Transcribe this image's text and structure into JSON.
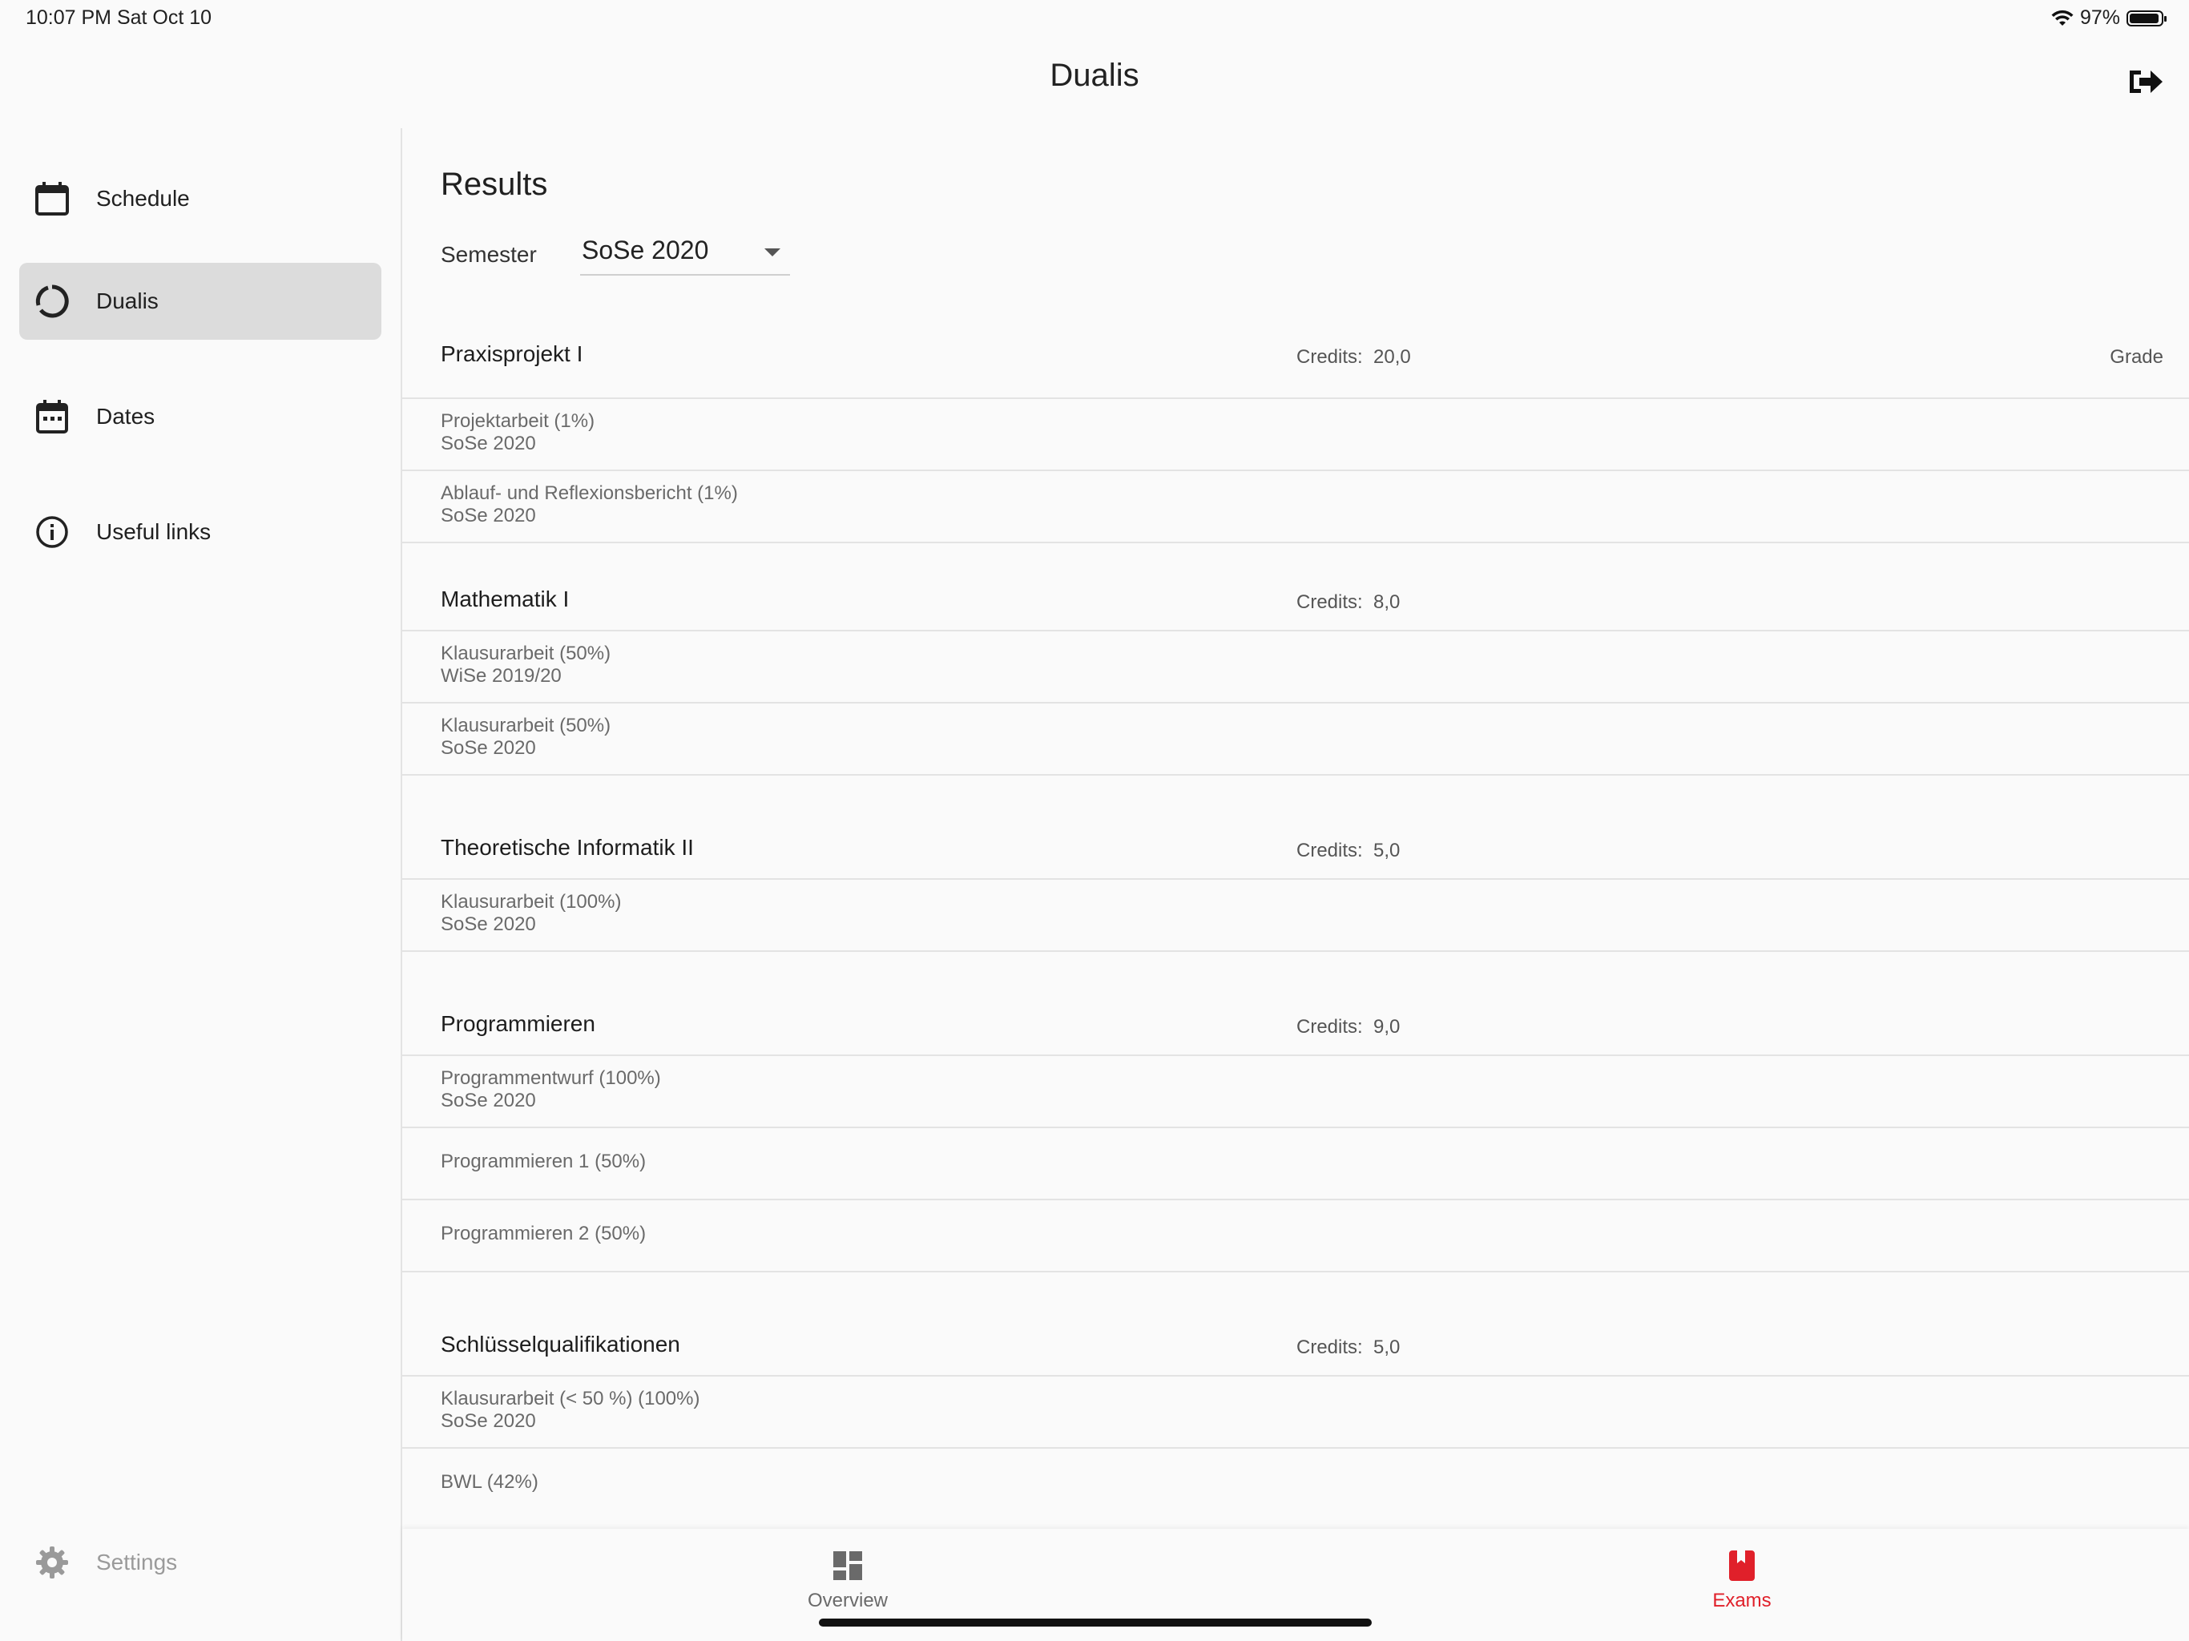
{
  "status": {
    "time": "10:07 PM   Sat Oct 10",
    "battery": "97%"
  },
  "app": {
    "title": "Dualis",
    "logout_icon": "logout-icon"
  },
  "sidebar": {
    "items": [
      {
        "label": "Schedule",
        "icon": "calendar-icon"
      },
      {
        "label": "Dualis",
        "icon": "circular-progress-icon",
        "active": true
      },
      {
        "label": "Dates",
        "icon": "calendar-dots-icon"
      },
      {
        "label": "Useful links",
        "icon": "info-icon"
      }
    ],
    "settings": {
      "label": "Settings",
      "icon": "gear-icon"
    }
  },
  "main": {
    "title": "Results",
    "semester_label": "Semester",
    "semester_value": "SoSe 2020",
    "credits_label": "Credits:",
    "grade_label": "Grade",
    "modules": [
      {
        "name": "Praxisprojekt I",
        "credits": "20,0",
        "exams": [
          {
            "name": "Projektarbeit (1%)",
            "semester": "SoSe 2020"
          },
          {
            "name": "Ablauf- und Reflexionsbericht (1%)",
            "semester": "SoSe 2020"
          }
        ]
      },
      {
        "name": "Mathematik I",
        "credits": "8,0",
        "exams": [
          {
            "name": "Klausurarbeit (50%)",
            "semester": "WiSe 2019/20"
          },
          {
            "name": "Klausurarbeit (50%)",
            "semester": "SoSe 2020"
          }
        ]
      },
      {
        "name": "Theoretische Informatik II",
        "credits": "5,0",
        "exams": [
          {
            "name": "Klausurarbeit (100%)",
            "semester": "SoSe 2020"
          }
        ]
      },
      {
        "name": "Programmieren",
        "credits": "9,0",
        "exams": [
          {
            "name": "Programmentwurf (100%)",
            "semester": "SoSe 2020"
          },
          {
            "name": "Programmieren 1 (50%)"
          },
          {
            "name": "Programmieren 2 (50%)"
          }
        ]
      },
      {
        "name": "Schlüsselqualifikationen",
        "credits": "5,0",
        "exams": [
          {
            "name": "Klausurarbeit (< 50 %) (100%)",
            "semester": "SoSe 2020"
          },
          {
            "name": "BWL (42%)"
          }
        ]
      }
    ]
  },
  "bottom_nav": {
    "tabs": [
      {
        "label": "Overview",
        "icon": "dashboard-icon"
      },
      {
        "label": "Exams",
        "icon": "bookmark-book-icon",
        "active": true
      }
    ],
    "active_color": "#e0202a"
  }
}
